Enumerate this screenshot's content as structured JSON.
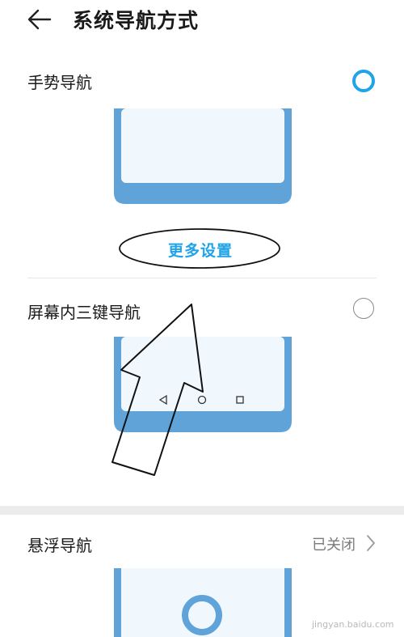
{
  "header": {
    "title": "系统导航方式"
  },
  "options": [
    {
      "label": "手势导航",
      "selected": true
    },
    {
      "label": "屏幕内三键导航",
      "selected": false
    }
  ],
  "more_settings": {
    "label": "更多设置"
  },
  "floating_nav": {
    "label": "悬浮导航",
    "status": "已关闭"
  },
  "watermark": {
    "text": "jingyan.baidu.com"
  },
  "colors": {
    "accent": "#1fa3e9",
    "phone_frame": "#5fa3d9",
    "phone_screen": "#f1f8fd"
  },
  "icons": [
    "back-arrow-icon",
    "chevron-right-icon",
    "nav-back-icon",
    "nav-home-icon",
    "nav-recent-icon",
    "floating-ring-icon"
  ]
}
